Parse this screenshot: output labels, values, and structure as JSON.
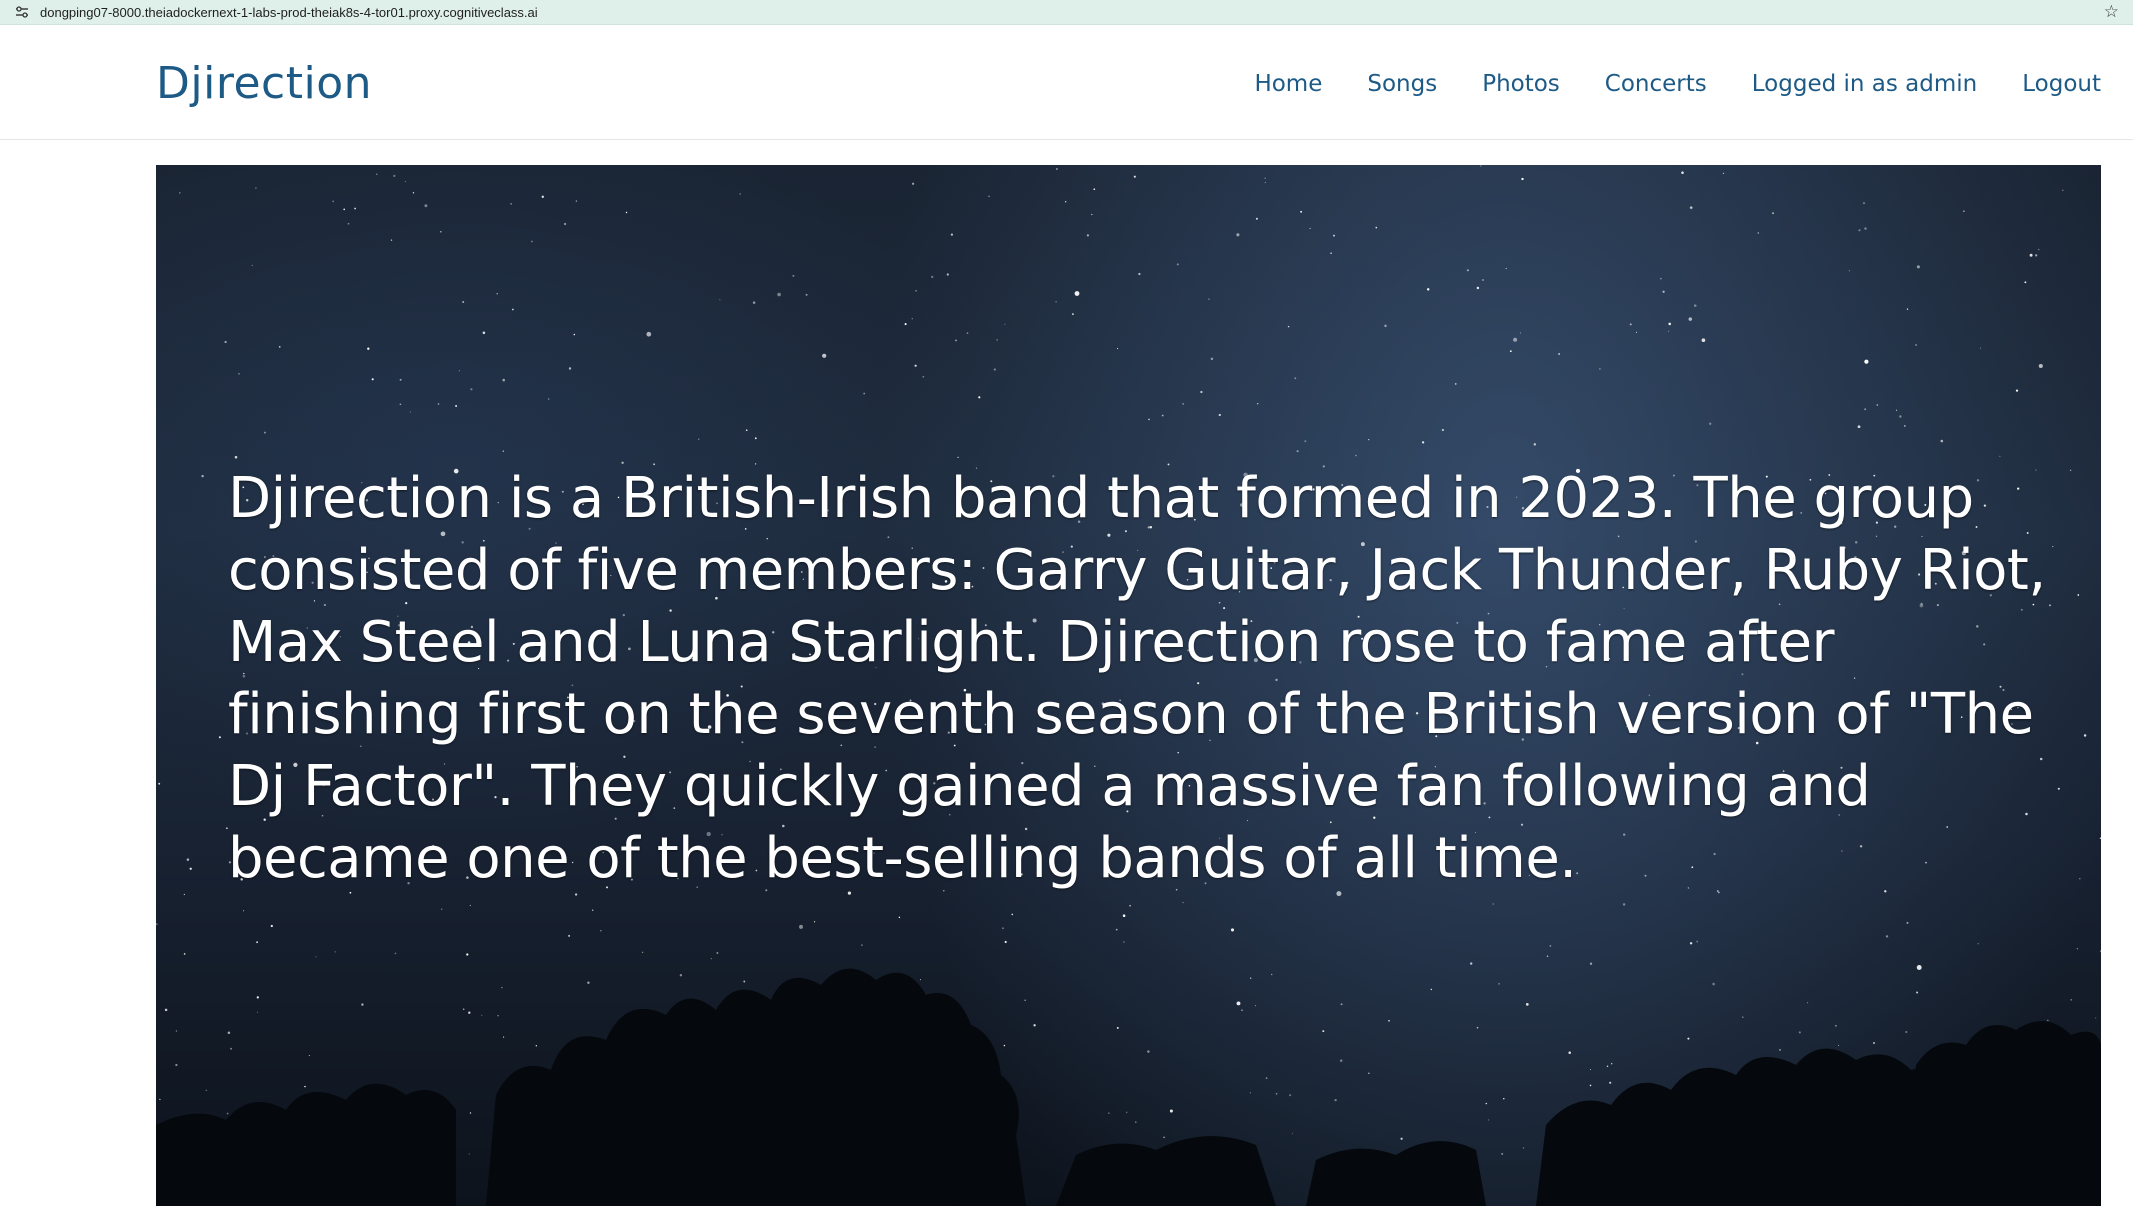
{
  "browser": {
    "url": "dongping07-8000.theiadockernext-1-labs-prod-theiak8s-4-tor01.proxy.cognitiveclass.ai",
    "site_info_icon": "tune-icon",
    "bookmark_icon": "star-outline-icon"
  },
  "navbar": {
    "brand": "Djirection",
    "links": {
      "home": "Home",
      "songs": "Songs",
      "photos": "Photos",
      "concerts": "Concerts",
      "user": "Logged in as admin",
      "logout": "Logout"
    },
    "link_color": "#1d5a86"
  },
  "hero": {
    "text": "Djirection is a British-Irish band that formed in 2023. The group consisted of five members: Garry Guitar, Jack Thunder, Ruby Riot, Max Steel and Luna Starlight. Djirection rose to fame after finishing first on the seventh season of the British version of \"The Dj Factor\". They quickly gained a massive fan following and became one of the best-selling bands of all time.",
    "background": "starry-night-sky-with-tree-silhouettes"
  }
}
